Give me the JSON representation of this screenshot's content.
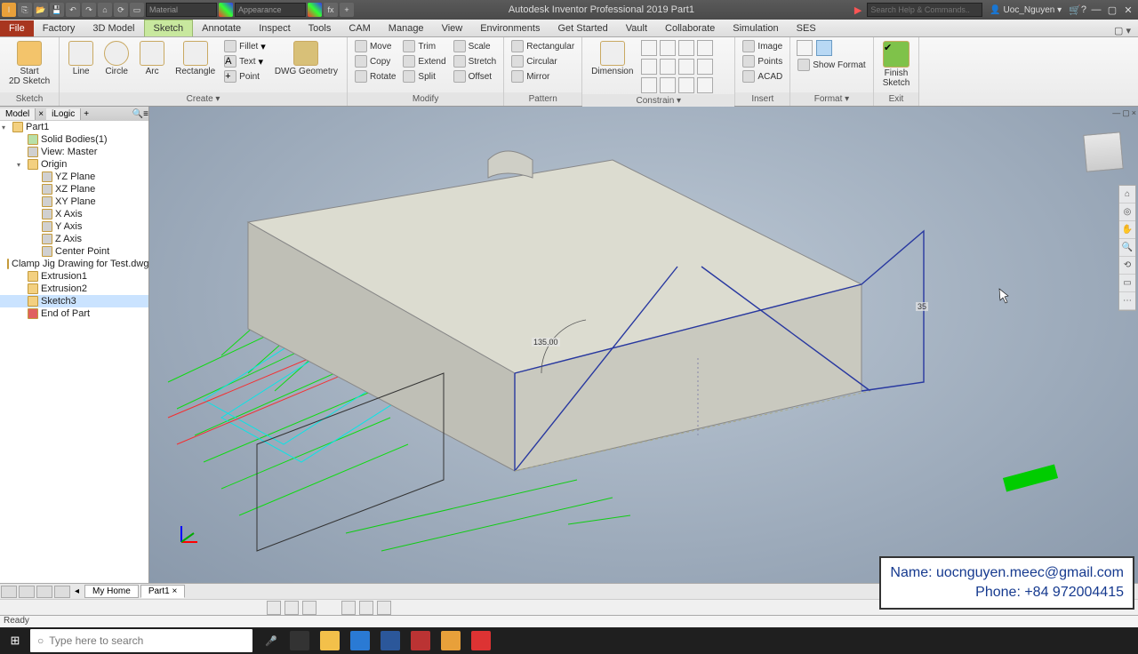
{
  "titlebar": {
    "material": "Material",
    "appearance": "Appearance",
    "title": "Autodesk Inventor Professional 2019   Part1",
    "search_placeholder": "Search Help & Commands..",
    "user": "Uoc_Nguyen"
  },
  "tabs": {
    "file": "File",
    "items": [
      "Factory",
      "3D Model",
      "Sketch",
      "Annotate",
      "Inspect",
      "Tools",
      "CAM",
      "Manage",
      "View",
      "Environments",
      "Get Started",
      "Vault",
      "Collaborate",
      "Simulation",
      "SES"
    ],
    "active": "Sketch"
  },
  "ribbon": {
    "sketch_panel": "Sketch",
    "start2d": "Start\n2D Sketch",
    "line": "Line",
    "circle": "Circle",
    "arc": "Arc",
    "rectangle": "Rectangle",
    "fillet": "Fillet",
    "text": "Text",
    "point": "Point",
    "dwg": "DWG Geometry",
    "create_panel": "Create  ▾",
    "move": "Move",
    "trim": "Trim",
    "scale": "Scale",
    "copy": "Copy",
    "extend": "Extend",
    "stretch": "Stretch",
    "rotate": "Rotate",
    "split": "Split",
    "offset": "Offset",
    "modify_panel": "Modify",
    "rect_pat": "Rectangular",
    "circ_pat": "Circular",
    "mirror": "Mirror",
    "pattern_panel": "Pattern",
    "dimension": "Dimension",
    "constrain_panel": "Constrain  ▾",
    "image": "Image",
    "points": "Points",
    "acad": "ACAD",
    "insert_panel": "Insert",
    "showformat": "Show Format",
    "format_panel": "Format  ▾",
    "finish": "Finish\nSketch",
    "exit": "Exit"
  },
  "browser": {
    "model_tab": "Model",
    "ilogic_tab": "iLogic",
    "root": "Part1",
    "nodes": [
      {
        "label": "Solid Bodies(1)",
        "ind": 14,
        "ic": "g"
      },
      {
        "label": "View: Master",
        "ind": 14,
        "ic": "p"
      },
      {
        "label": "Origin",
        "ind": 14,
        "ic": "",
        "exp": true
      },
      {
        "label": "YZ Plane",
        "ind": 30,
        "ic": "p"
      },
      {
        "label": "XZ Plane",
        "ind": 30,
        "ic": "p"
      },
      {
        "label": "XY Plane",
        "ind": 30,
        "ic": "p"
      },
      {
        "label": "X Axis",
        "ind": 30,
        "ic": "p"
      },
      {
        "label": "Y Axis",
        "ind": 30,
        "ic": "p"
      },
      {
        "label": "Z Axis",
        "ind": 30,
        "ic": "p"
      },
      {
        "label": "Center Point",
        "ind": 30,
        "ic": "p"
      },
      {
        "label": "Clamp Jig Drawing for Test.dwg",
        "ind": 14,
        "ic": ""
      },
      {
        "label": "Extrusion1",
        "ind": 14,
        "ic": ""
      },
      {
        "label": "Extrusion2",
        "ind": 14,
        "ic": ""
      },
      {
        "label": "Sketch3",
        "ind": 14,
        "ic": "",
        "sel": true
      },
      {
        "label": "End of Part",
        "ind": 14,
        "ic": "r"
      }
    ]
  },
  "canvas": {
    "dim_angle": "135.00",
    "dim_height": "35"
  },
  "doctabs": {
    "home": "My Home",
    "part": "Part1"
  },
  "status": "Ready",
  "taskbar": {
    "search": "Type here to search"
  },
  "overlay": {
    "name": "Name: uocnguyen.meec@gmail.com",
    "phone": "Phone: +84 972004415"
  }
}
